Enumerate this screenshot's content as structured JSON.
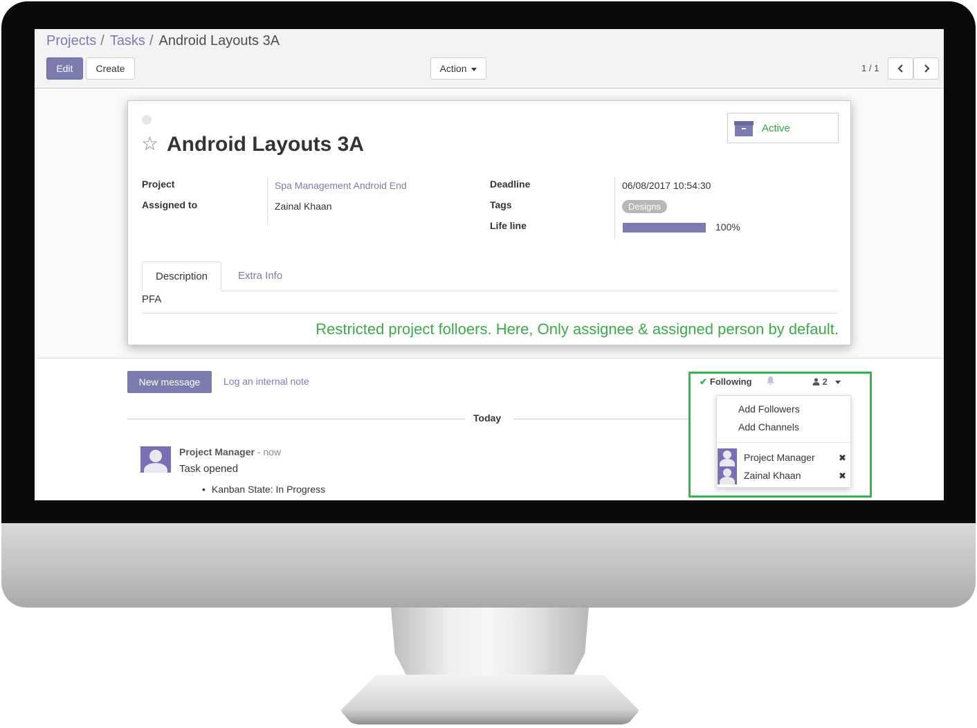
{
  "breadcrumb": {
    "items": [
      "Projects",
      "Tasks"
    ],
    "separator": "/",
    "current": "Android Layouts 3A"
  },
  "toolbar": {
    "edit_label": "Edit",
    "create_label": "Create",
    "action_label": "Action",
    "pager_value": "1 / 1"
  },
  "record": {
    "title": "Android Layouts 3A",
    "status_label": "Active",
    "project_label": "Project",
    "project_value": "Spa Management Android End",
    "assigned_label": "Assigned to",
    "assigned_value": "Zainal Khaan",
    "deadline_label": "Deadline",
    "deadline_value": "06/08/2017 10:54:30",
    "tags_label": "Tags",
    "tag_value": "Designs",
    "lifeline_label": "Life line",
    "lifeline_percent": 100,
    "lifeline_text": "100%"
  },
  "tabs": [
    {
      "label": "Description",
      "active": true
    },
    {
      "label": "Extra Info",
      "active": false
    }
  ],
  "description_text": "PFA",
  "annotation_text": "Restricted project folloers. Here, Only assignee & assigned person by default.",
  "chatter": {
    "new_message_label": "New message",
    "log_note_label": "Log an internal note",
    "date_separator": "Today",
    "message": {
      "author": "Project Manager",
      "time": "- now",
      "body": "Task opened",
      "bullets": [
        "Kanban State: In Progress"
      ]
    }
  },
  "followers": {
    "following_label": "Following",
    "count": "2",
    "menu_items": [
      "Add Followers",
      "Add Channels"
    ],
    "list": [
      {
        "name": "Project Manager",
        "remove": "✖"
      },
      {
        "name": "Zainal Khaan",
        "remove": "✖"
      }
    ]
  },
  "icons": {
    "star": "star-icon",
    "archive": "archive-icon",
    "check": "check-icon",
    "bell": "bell-icon",
    "user": "user-icon",
    "caret": "caret-down-icon",
    "chevron_left": "chevron-left-icon",
    "chevron_right": "chevron-right-icon"
  },
  "colors": {
    "primary": "#7c7bad",
    "success": "#3cab48",
    "highlight_border": "#3ab54a"
  }
}
